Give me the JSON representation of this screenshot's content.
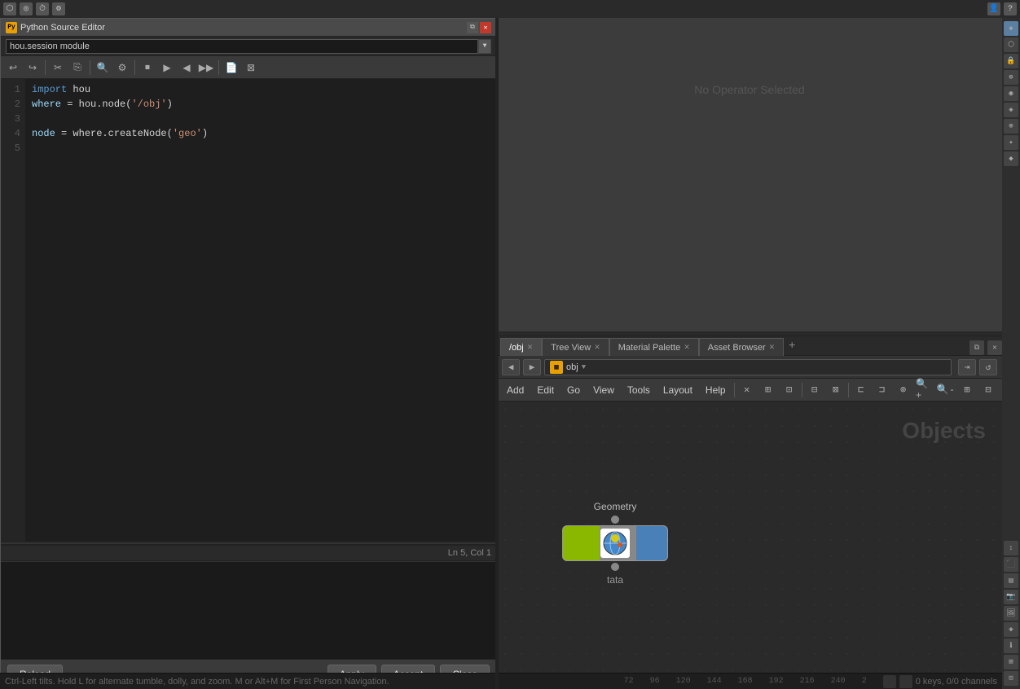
{
  "app": {
    "title": "Python Source Editor",
    "bg_color": "#3c3c3c"
  },
  "topbar": {
    "icons": [
      "⬡",
      "◎",
      "⏱",
      "⚙"
    ]
  },
  "python_editor": {
    "title": "Python Source Editor",
    "module": "hou.session module",
    "code_lines": [
      {
        "num": "1",
        "content": "import hou"
      },
      {
        "num": "2",
        "content": "where = hou.node('/obj')"
      },
      {
        "num": "3",
        "content": ""
      },
      {
        "num": "4",
        "content": "node = where.createNode('geo')"
      },
      {
        "num": "5",
        "content": ""
      }
    ],
    "status": "Ln 5, Col 1",
    "buttons": {
      "reload": "Reload",
      "apply": "Apply",
      "accept": "Accept",
      "close": "Close"
    },
    "toolbar_icons": [
      "↩",
      "↪",
      "✂",
      "📋",
      "🔍",
      "⚙",
      "◼",
      "▶",
      "◀",
      "▶▶",
      "⏹",
      "🔲",
      "📄"
    ]
  },
  "node_graph": {
    "tabs": [
      {
        "label": "/obj",
        "active": true
      },
      {
        "label": "Tree View",
        "active": false
      },
      {
        "label": "Material Palette",
        "active": false
      },
      {
        "label": "Asset Browser",
        "active": false
      }
    ],
    "path": "obj",
    "menu": [
      "Add",
      "Edit",
      "Go",
      "View",
      "Tools",
      "Layout",
      "Help"
    ],
    "objects_label": "Objects",
    "node": {
      "type": "Geometry",
      "name": "tata"
    },
    "no_operator": "No Operator Selected"
  },
  "bottom_status": {
    "text": "Ctrl-Left tilts. Hold L for alternate tumble, dolly, and zoom.    M or Alt+M for First Person Navigation.",
    "coords": [
      "72",
      "96",
      "120",
      "144",
      "168",
      "192",
      "216",
      "240",
      "2"
    ],
    "right_info": "0 keys, 0/0 channels"
  }
}
